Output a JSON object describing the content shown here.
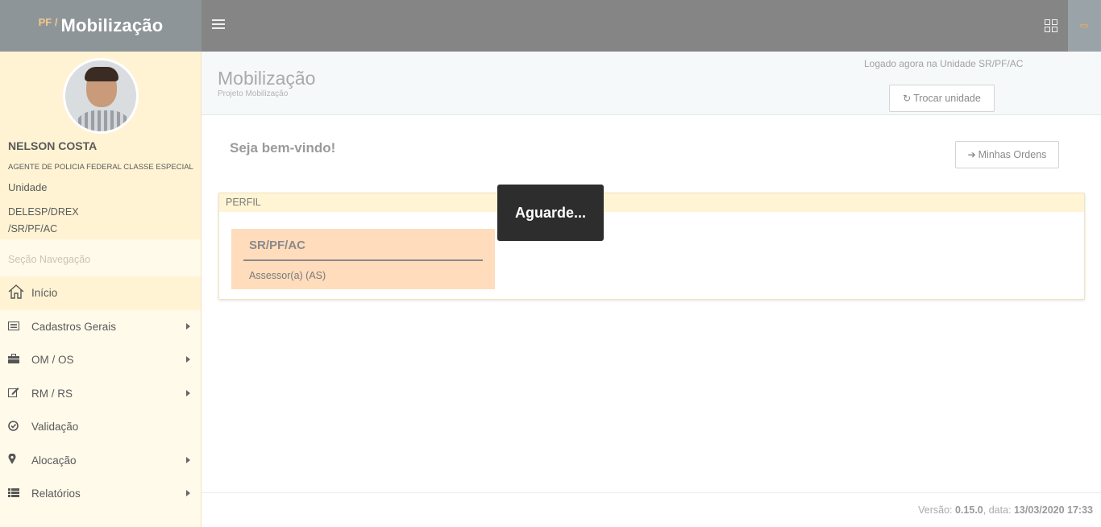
{
  "topbar": {
    "brand_prefix": "PF /",
    "brand_title": "Mobilização",
    "icons": [
      "hamburger-icon",
      "grid-icon",
      "logout-icon"
    ]
  },
  "sidebar": {
    "user": {
      "name": "NELSON COSTA",
      "role": "AGENTE DE POLICIA FEDERAL CLASSE ESPECIAL",
      "unit_label": "Unidade",
      "unit_line1": "DELESP/DREX",
      "unit_line2": "/SR/PF/AC"
    },
    "section_label": "Seção Navegação",
    "items": [
      {
        "label": "Início",
        "icon": "home-icon"
      },
      {
        "label": "Cadastros Gerais",
        "icon": "list-icon"
      },
      {
        "label": "OM / OS",
        "icon": "briefcase-icon"
      },
      {
        "label": "RM / RS",
        "icon": "edit-icon"
      },
      {
        "label": "Validação",
        "icon": "check-circle-icon"
      },
      {
        "label": "Alocação",
        "icon": "map-marker-icon"
      },
      {
        "label": "Relatórios",
        "icon": "table-icon"
      }
    ]
  },
  "header": {
    "title": "Mobilização",
    "subtitle": "Projeto Mobilização",
    "logged_text": "Logado agora na Unidade SR/PF/AC",
    "switch_unit_label": "Trocar unidade"
  },
  "main": {
    "welcome": "Seja bem-vindo!",
    "my_orders_label": "Minhas Ordens",
    "panel_title": "PERFIL",
    "profile_card": {
      "unit": "SR/PF/AC",
      "role": "Assessor(a) (AS)"
    }
  },
  "footer": {
    "version_label": "Versão:",
    "version": "0.15.0",
    "date_label": ", data:",
    "date": "13/03/2020 17:33"
  },
  "overlay": {
    "text": "Aguarde..."
  },
  "colors": {
    "topbar": "#858585",
    "sidebar": "#fffaea",
    "panel_header": "#fff4d3",
    "card": "#ffdcbc",
    "overlay": "#2d2d2d",
    "logout_icon": "#f0b050"
  }
}
